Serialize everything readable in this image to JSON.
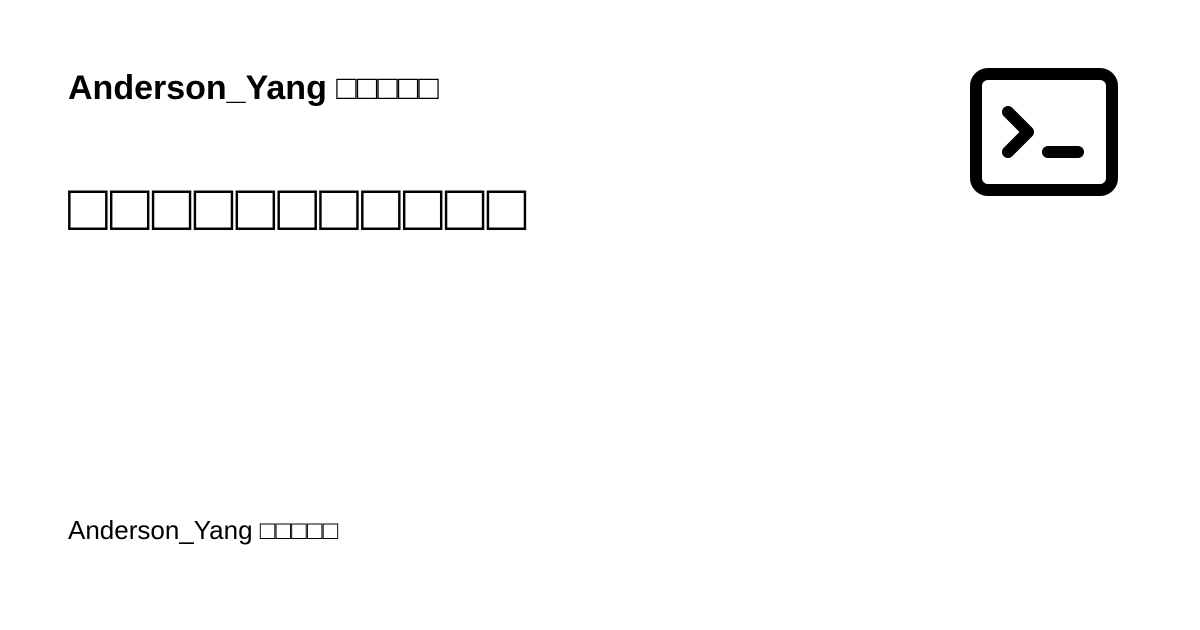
{
  "header": {
    "site_name": "Anderson_Yang □□□□□"
  },
  "main": {
    "headline": "□□□□□□□□□□□"
  },
  "footer": {
    "author": "Anderson_Yang □□□□□"
  },
  "icons": {
    "logo": "terminal-icon"
  },
  "colors": {
    "background": "#ffffff",
    "text": "#000000"
  }
}
